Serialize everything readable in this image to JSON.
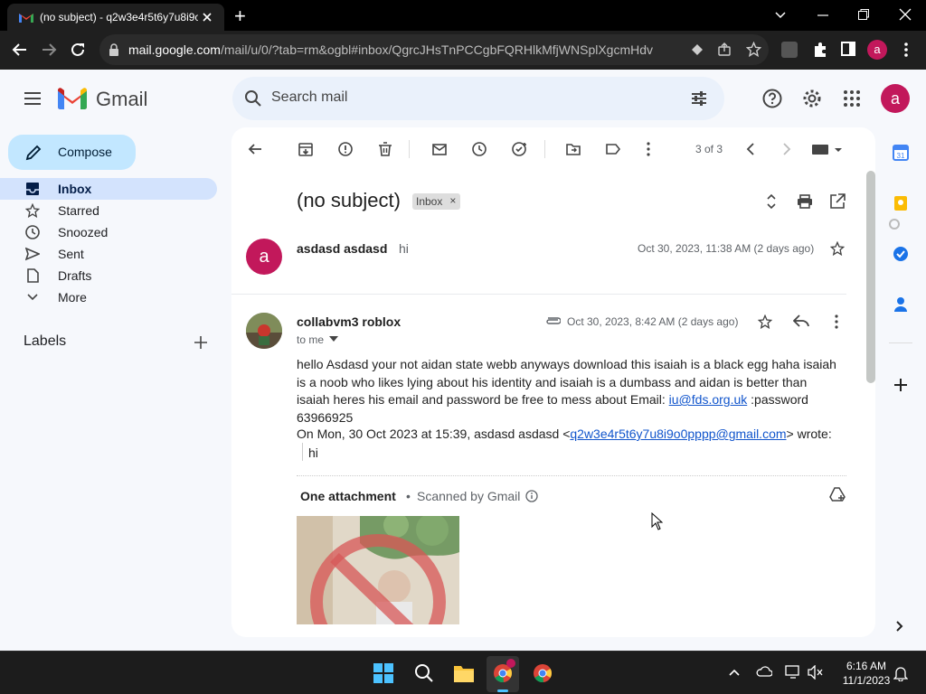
{
  "browser": {
    "tab_title": "(no subject) - q2w3e4r5t6y7u8i9o",
    "new_tab_symbol": "+",
    "url_host": "mail.google.com",
    "url_path": "/mail/u/0/?tab=rm&ogbl#inbox/QgrcJHsTnPCCgbFQRHlkMfjWNSplXgcmHdv",
    "profile_initial": "a"
  },
  "gmail": {
    "brand": "Gmail",
    "search_placeholder": "Search mail",
    "account_initial": "a"
  },
  "sidebar": {
    "compose_label": "Compose",
    "items": [
      {
        "label": "Inbox",
        "icon": "inbox-icon",
        "active": true
      },
      {
        "label": "Starred",
        "icon": "star-icon"
      },
      {
        "label": "Snoozed",
        "icon": "clock-icon"
      },
      {
        "label": "Sent",
        "icon": "send-icon"
      },
      {
        "label": "Drafts",
        "icon": "draft-icon"
      },
      {
        "label": "More",
        "icon": "chevron-down-icon"
      }
    ],
    "labels_heading": "Labels"
  },
  "toolbar": {
    "pagination": "3 of 3"
  },
  "thread": {
    "subject": "(no subject)",
    "label_chip": "Inbox",
    "messages": [
      {
        "sender": "asdasd asdasd",
        "snippet": "hi",
        "date": "Oct 30, 2023, 11:38 AM (2 days ago)",
        "avatar_initial": "a"
      },
      {
        "sender": "collabvm3 roblox",
        "to": "to me",
        "date": "Oct 30, 2023, 8:42 AM (2 days ago)",
        "body_text": "hello Asdasd your not aidan state webb anyways download this isaiah is a black egg haha isaiah is a noob who likes lying about his identity and isaiah is a dumbass and aidan is better than isaiah heres his email and password be free to mess about Email: ",
        "body_link": "iu@fds.org.uk",
        "body_after": " :password 63966925",
        "quote_intro": "On Mon, 30 Oct 2023 at 15:39, asdasd asdasd <",
        "quote_email": "q2w3e4r5t6y7u8i9o0pppp@gmail.com",
        "quote_outro": "> wrote:",
        "quoted_text": "hi"
      }
    ],
    "attachment_heading": "One attachment",
    "attachment_scanned": "Scanned by Gmail"
  },
  "taskbar": {
    "time": "6:16 AM",
    "date": "11/1/2023"
  },
  "colors": {
    "avatar": "#c2185b",
    "compose_bg": "#c2e7ff",
    "active_nav": "#d3e3fd",
    "page_bg": "#f6f8fc"
  }
}
